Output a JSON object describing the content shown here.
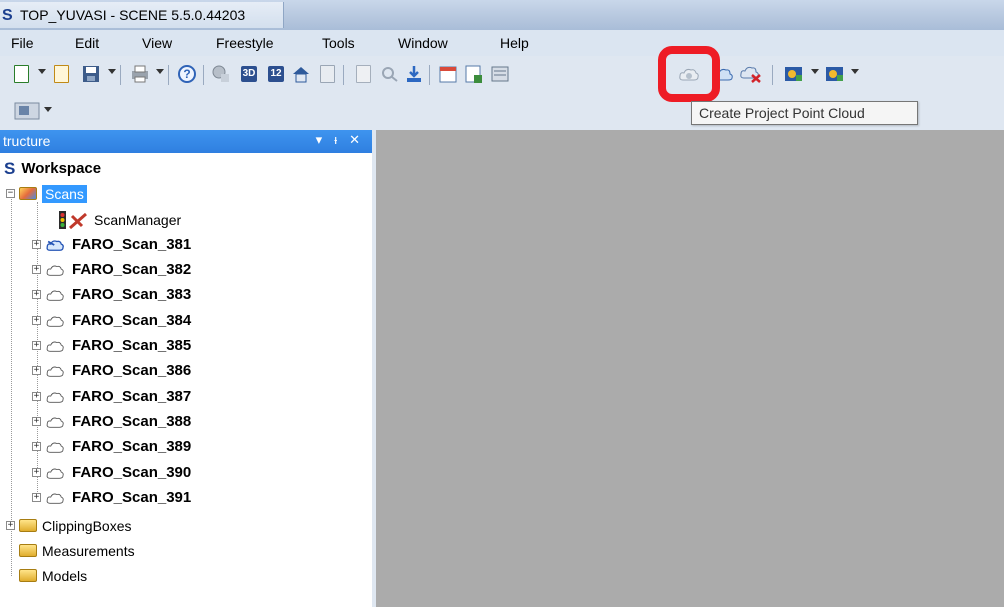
{
  "window": {
    "title": "TOP_YUVASI - SCENE 5.5.0.44203",
    "logo": "S"
  },
  "menu": [
    "File",
    "Edit",
    "View",
    "Freestyle",
    "Tools",
    "Window",
    "Help"
  ],
  "toolbar": {
    "icons": [
      "new-project-icon",
      "open-icon",
      "save-icon",
      "print-icon",
      "help-icon",
      "scan-view-icon",
      "3d-view-icon",
      "planar-view-icon",
      "home-view-icon",
      "workspace-icon",
      "copy-icon",
      "find-icon",
      "import-icon",
      "calendar-icon",
      "report-icon",
      "register-icon",
      "create-point-cloud-icon",
      "cloud-settings-icon",
      "delete-cloud-icon",
      "layer-icon",
      "layer-add-icon"
    ],
    "badge_3d": "3D",
    "badge_12": "12",
    "help_glyph": "?"
  },
  "tooltip": "Create Project Point Cloud",
  "panel": {
    "title": "tructure",
    "controls": [
      "▾",
      "ᵻ",
      "✕"
    ]
  },
  "tree": {
    "workspace": "Workspace",
    "scans": "Scans",
    "scan_manager": "ScanManager",
    "items": [
      "FARO_Scan_381",
      "FARO_Scan_382",
      "FARO_Scan_383",
      "FARO_Scan_384",
      "FARO_Scan_385",
      "FARO_Scan_386",
      "FARO_Scan_387",
      "FARO_Scan_388",
      "FARO_Scan_389",
      "FARO_Scan_390",
      "FARO_Scan_391"
    ],
    "folders": [
      "ClippingBoxes",
      "Measurements",
      "Models"
    ]
  },
  "colors": {
    "highlight_ring": "#ee1c25",
    "selection": "#3399ff",
    "panel_header": "#3088e8",
    "viewport": "#ababab"
  }
}
